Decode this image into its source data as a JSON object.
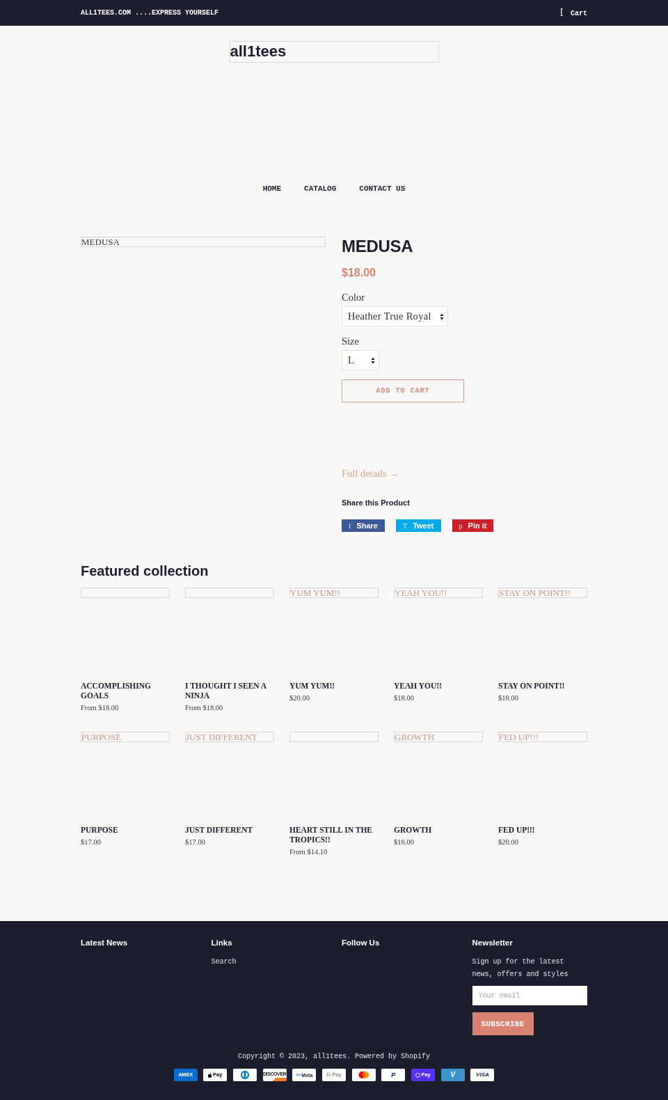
{
  "announcement": {
    "message": "ALL1TEES.COM ....EXPRESS YOURSELF",
    "cart_glyph": "[",
    "cart_label": "Cart"
  },
  "logo": {
    "alt_text": "all1tees"
  },
  "nav": [
    {
      "label": "HOME"
    },
    {
      "label": "CATALOG"
    },
    {
      "label": "CONTACT US"
    }
  ],
  "product": {
    "image_alt": "MEDUSA",
    "title": "MEDUSA",
    "price": "$18.00",
    "options": [
      {
        "label": "Color",
        "value": "Heather True Royal"
      },
      {
        "label": "Size",
        "value": "L"
      }
    ],
    "add_to_cart": "ADD TO CART",
    "full_details": "Full details →",
    "share_heading": "Share this Product",
    "share_buttons": [
      {
        "kind": "facebook",
        "glyph": "f",
        "label": "Share"
      },
      {
        "kind": "twitter",
        "glyph": "T",
        "label": "Tweet"
      },
      {
        "kind": "pinterest",
        "glyph": "p",
        "label": "Pin it"
      }
    ]
  },
  "featured": {
    "heading": "Featured collection",
    "products": [
      {
        "title": "ACCOMPLISHING GOALS",
        "price": "From $18.00"
      },
      {
        "title": "I THOUGHT I SEEN A NINJA",
        "price": "From $18.00"
      },
      {
        "image_alt": "YUM YUM!!",
        "title": "YUM YUM!!",
        "price": "$20.00"
      },
      {
        "image_alt": "YEAH YOU!!",
        "title": "YEAH YOU!!",
        "price": "$18.00"
      },
      {
        "image_alt": "STAY ON POINT!!",
        "title": "STAY ON POINT!!",
        "price": "$18.00"
      },
      {
        "image_alt": "PURPOSE",
        "title": "PURPOSE",
        "price": "$17.00"
      },
      {
        "image_alt": "JUST DIFFERENT",
        "title": "JUST DIFFERENT",
        "price": "$17.00"
      },
      {
        "title": "HEART STILL IN THE TROPICS!!",
        "price": "From $14.10"
      },
      {
        "image_alt": "GROWTH",
        "title": "GROWTH",
        "price": "$18.00"
      },
      {
        "image_alt": "FED UP!!!",
        "title": "FED UP!!!",
        "price": "$20.00"
      }
    ]
  },
  "footer": {
    "columns": [
      {
        "kind": "list",
        "heading": "Latest News"
      },
      {
        "kind": "list",
        "heading": "Links",
        "links": [
          "Search"
        ]
      },
      {
        "kind": "list",
        "heading": "Follow Us"
      },
      {
        "kind": "newsletter",
        "heading": "Newsletter",
        "text": "Sign up for the latest news, offers and styles",
        "placeholder": "Your email",
        "button": "SUBSCRIBE"
      }
    ],
    "copyright": "Copyright © 2023, all1tees. Powered by Shopify",
    "payment_icons": [
      {
        "kind": "amex",
        "text": "AMEX"
      },
      {
        "kind": "apple_pay",
        "text": "Pay"
      },
      {
        "kind": "diners"
      },
      {
        "kind": "discover",
        "text": "DISCOVER"
      },
      {
        "kind": "meta_pay",
        "text": "Meta"
      },
      {
        "kind": "google_pay",
        "text": "G Pay"
      },
      {
        "kind": "mastercard"
      },
      {
        "kind": "paypal",
        "text": "P"
      },
      {
        "kind": "shop_pay",
        "text": "Pay"
      },
      {
        "kind": "venmo",
        "text": "V"
      },
      {
        "kind": "visa",
        "text": "VISA"
      }
    ]
  }
}
